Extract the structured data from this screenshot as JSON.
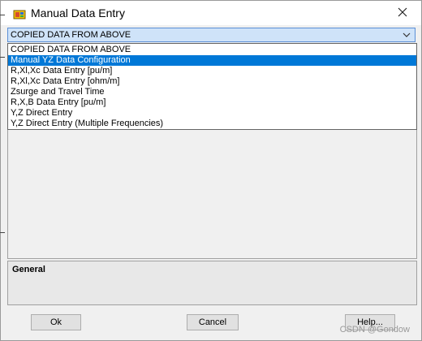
{
  "window": {
    "title": "Manual Data Entry",
    "close_glyph": "✕"
  },
  "combo": {
    "value": "COPIED DATA FROM ABOVE"
  },
  "dropdown": {
    "items": [
      {
        "label": "COPIED DATA FROM ABOVE",
        "selected": false
      },
      {
        "label": "Manual YZ Data Configuration",
        "selected": true
      },
      {
        "label": "R,Xl,Xc Data Entry [pu/m]",
        "selected": false
      },
      {
        "label": "R,Xl,Xc Data Entry [ohm/m]",
        "selected": false
      },
      {
        "label": "Zsurge and Travel Time",
        "selected": false
      },
      {
        "label": "R,X,B Data Entry [pu/m]",
        "selected": false
      },
      {
        "label": "Y,Z Direct Entry",
        "selected": false
      },
      {
        "label": "Y,Z Direct Entry (Multiple Frequencies)",
        "selected": false
      }
    ]
  },
  "general": {
    "title": "General"
  },
  "buttons": {
    "ok": "Ok",
    "cancel": "Cancel",
    "help": "Help..."
  },
  "watermark": "CSDN @Gondow",
  "colors": {
    "accent": "#0078d7",
    "combo_bg": "#cfe3f9"
  }
}
